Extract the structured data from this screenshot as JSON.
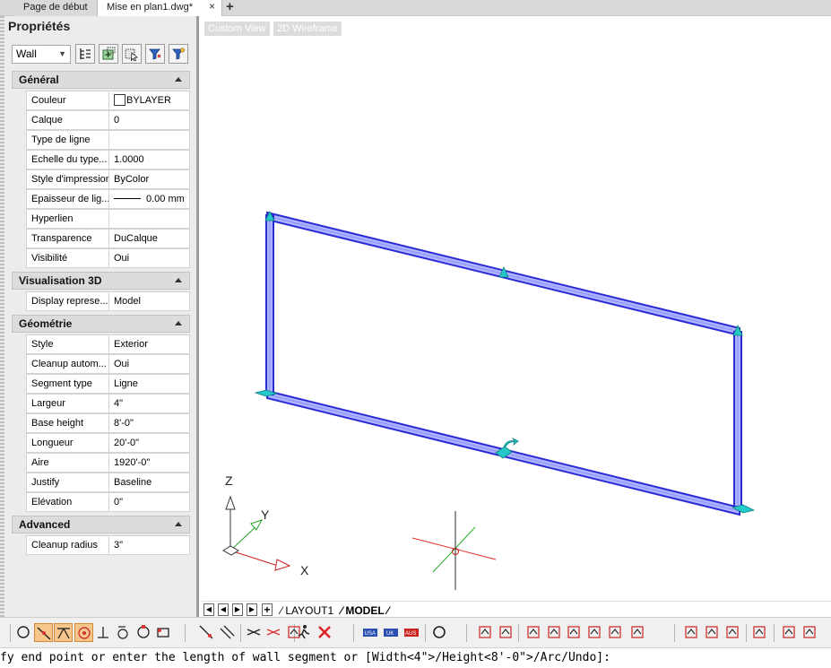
{
  "tabs": {
    "home": "Page de début",
    "active": "Mise en plan1.dwg*",
    "close": "×",
    "add": "+"
  },
  "properties": {
    "title": "Propriétés",
    "entity": "Wall",
    "sections": {
      "general": {
        "title": "Général",
        "rows": [
          {
            "key": "Couleur",
            "value": "BYLAYER"
          },
          {
            "key": "Calque",
            "value": "0"
          },
          {
            "key": "Type de ligne",
            "value": ""
          },
          {
            "key": "Echelle du type...",
            "value": "1.0000"
          },
          {
            "key": "Style d'impression",
            "value": "ByColor"
          },
          {
            "key": "Epaisseur de lig...",
            "value": "0.00 mm"
          },
          {
            "key": "Hyperlien",
            "value": ""
          },
          {
            "key": "Transparence",
            "value": "DuCalque"
          },
          {
            "key": "Visibilité",
            "value": "Oui"
          }
        ]
      },
      "visualisation": {
        "title": "Visualisation 3D",
        "rows": [
          {
            "key": "Display represe...",
            "value": "Model"
          }
        ]
      },
      "geometrie": {
        "title": "Géométrie",
        "rows": [
          {
            "key": "Style",
            "value": "Exterior"
          },
          {
            "key": "Cleanup autom...",
            "value": "Oui"
          },
          {
            "key": "Segment type",
            "value": "Ligne"
          },
          {
            "key": "Largeur",
            "value": "4\""
          },
          {
            "key": "Base height",
            "value": "8'-0\""
          },
          {
            "key": "Longueur",
            "value": "20'-0\""
          },
          {
            "key": "Aire",
            "value": "1920'-0\""
          },
          {
            "key": "Justify",
            "value": "Baseline"
          },
          {
            "key": "Elévation",
            "value": "0\""
          }
        ]
      },
      "advanced": {
        "title": "Advanced",
        "rows": [
          {
            "key": "Cleanup radius",
            "value": "3\""
          }
        ]
      }
    }
  },
  "viewport": {
    "view_label": "Custom View",
    "style_label": "2D Wireframe",
    "axis_z": "Z",
    "axis_y": "Y",
    "axis_x": "X"
  },
  "layouts": {
    "tabs": [
      "LAYOUT1",
      "MODEL"
    ],
    "active": "MODEL",
    "add": "+"
  },
  "command_line": {
    "text": "fy end point or enter the length of wall segment or [Width<4\">/Height<8'-0\">/Arc/Undo]:"
  },
  "colors": {
    "wall_outline": "#2b2bd6",
    "wall_fill": "#aeb4ff",
    "grip": "#23c9c9",
    "toolbar_active": "#f6c68a"
  },
  "toolbar_icons": [
    "snap-endpoint-icon",
    "snap-midpoint-icon",
    "snap-center-icon",
    "snap-node-icon",
    "snap-perpendicular-icon",
    "snap-tangent-icon",
    "snap-quadrant-icon",
    "snap-insertion-icon",
    "snap-nearest-icon",
    "snap-parallel-icon",
    "snap-extension-icon",
    "snap-intersection-icon",
    "snap-apparent-icon",
    "track-icon",
    "clear-snaps-icon",
    "usa-icon",
    "uk-icon",
    "aus-icon",
    "circle-icon",
    "wall-icon",
    "window-icon",
    "door-icon",
    "opening-icon",
    "stair-icon",
    "slab-icon",
    "column-icon",
    "beam-icon",
    "railing-icon",
    "roof-icon",
    "curtain-wall-icon",
    "space-icon",
    "zone-icon",
    "grid-icon",
    "section-icon",
    "elevation-icon",
    "target-icon",
    "settings-icon"
  ]
}
